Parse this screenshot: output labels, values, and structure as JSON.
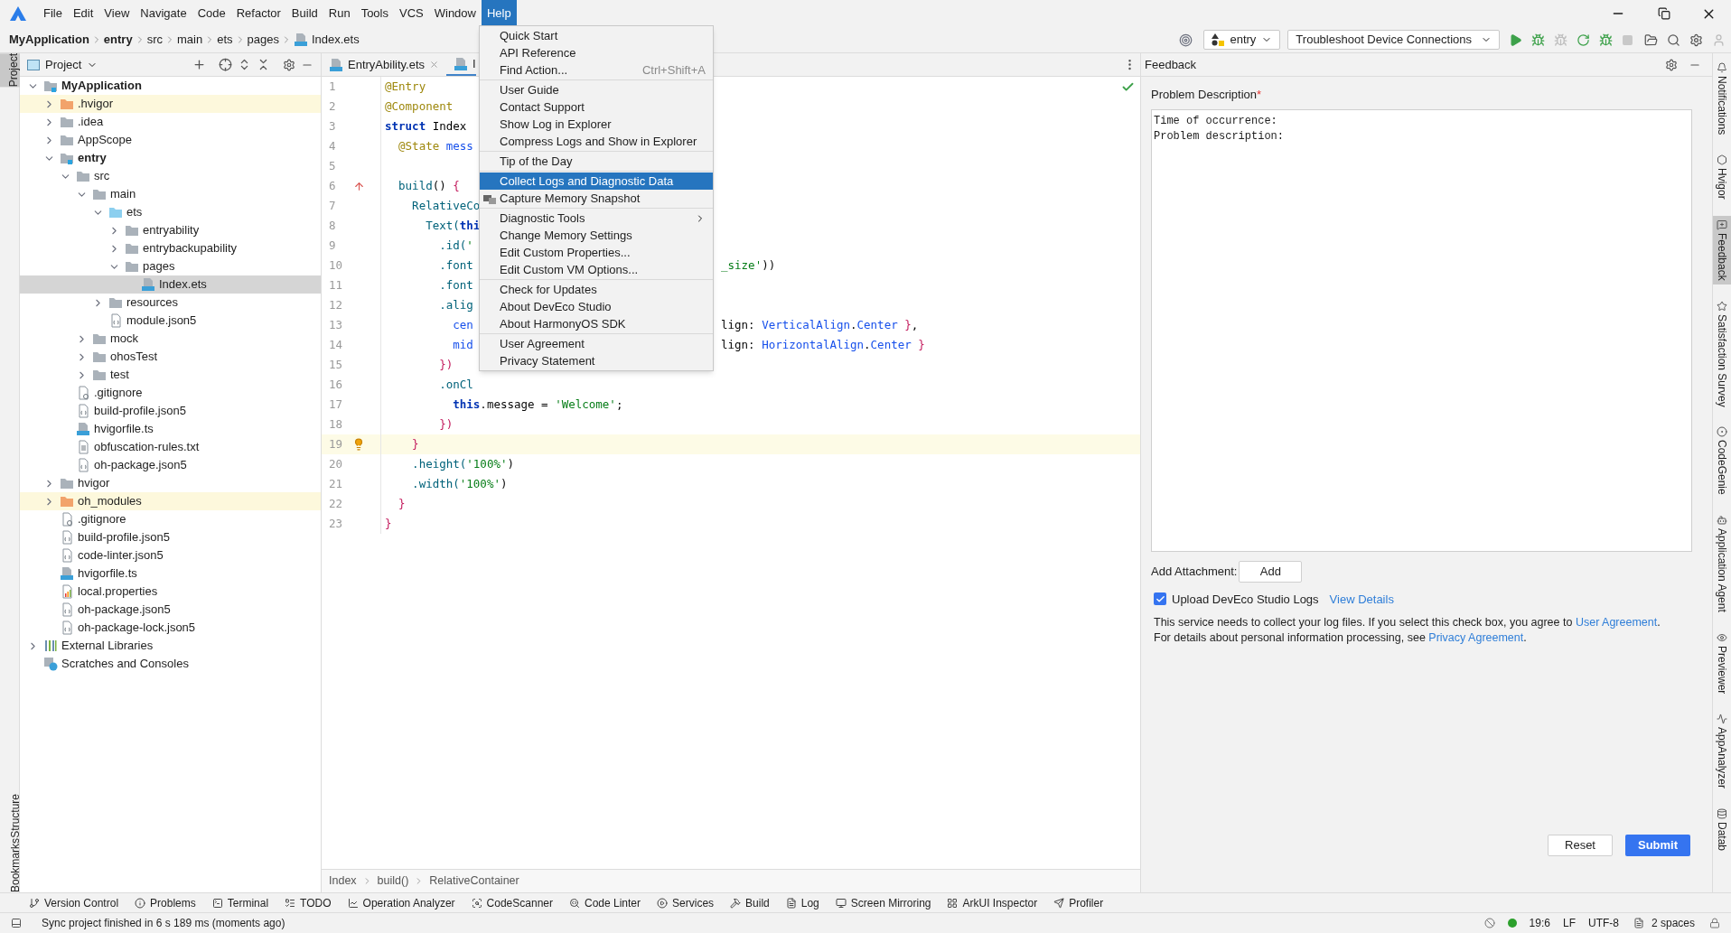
{
  "menu_bar": {
    "items": [
      {
        "label": "File",
        "selected": false
      },
      {
        "label": "Edit",
        "selected": false
      },
      {
        "label": "View",
        "selected": false
      },
      {
        "label": "Navigate",
        "selected": false
      },
      {
        "label": "Code",
        "selected": false
      },
      {
        "label": "Refactor",
        "selected": false
      },
      {
        "label": "Build",
        "selected": false
      },
      {
        "label": "Run",
        "selected": false
      },
      {
        "label": "Tools",
        "selected": false
      },
      {
        "label": "VCS",
        "selected": false
      },
      {
        "label": "Window",
        "selected": false
      },
      {
        "label": "Help",
        "selected": true
      }
    ]
  },
  "nav_bar": {
    "breadcrumbs": [
      {
        "label": "MyApplication",
        "kind": "module"
      },
      {
        "label": "entry",
        "kind": "module"
      },
      {
        "label": "src",
        "kind": "folder"
      },
      {
        "label": "main",
        "kind": "folder"
      },
      {
        "label": "ets",
        "kind": "folder"
      },
      {
        "label": "pages",
        "kind": "folder"
      },
      {
        "label": "Index.ets",
        "kind": "file"
      }
    ],
    "run_config": "entry",
    "device": "Troubleshoot Device Connections"
  },
  "help_menu": {
    "groups": [
      [
        {
          "label": "Quick Start",
          "kind": "plain",
          "selected": false
        },
        {
          "label": "API Reference",
          "kind": "plain",
          "selected": false
        },
        {
          "label": "Find Action...",
          "kind": "plain",
          "shortcut": "Ctrl+Shift+A",
          "selected": false
        }
      ],
      [
        {
          "label": "User Guide",
          "kind": "plain",
          "selected": false
        },
        {
          "label": "Contact Support",
          "kind": "plain",
          "selected": false
        },
        {
          "label": "Show Log in Explorer",
          "kind": "plain",
          "selected": false
        },
        {
          "label": "Compress Logs and Show in Explorer",
          "kind": "plain",
          "selected": false
        }
      ],
      [
        {
          "label": "Tip of the Day",
          "kind": "plain",
          "selected": false
        }
      ],
      [
        {
          "label": "Collect Logs and Diagnostic Data",
          "kind": "plain",
          "selected": true
        },
        {
          "label": "Capture Memory Snapshot",
          "kind": "with-icon",
          "selected": false
        }
      ],
      [
        {
          "label": "Diagnostic Tools",
          "kind": "submenu",
          "selected": false
        },
        {
          "label": "Change Memory Settings",
          "kind": "plain",
          "selected": false
        },
        {
          "label": "Edit Custom Properties...",
          "kind": "plain",
          "selected": false
        },
        {
          "label": "Edit Custom VM Options...",
          "kind": "plain",
          "selected": false
        }
      ],
      [
        {
          "label": "Check for Updates",
          "kind": "plain",
          "selected": false
        },
        {
          "label": "About DevEco Studio",
          "kind": "plain",
          "selected": false
        },
        {
          "label": "About HarmonyOS SDK",
          "kind": "plain",
          "selected": false
        }
      ],
      [
        {
          "label": "User Agreement",
          "kind": "plain",
          "selected": false
        },
        {
          "label": "Privacy Statement",
          "kind": "plain",
          "selected": false
        }
      ]
    ]
  },
  "left_stripe": {
    "top_tabs": [
      {
        "label": "Project",
        "selected": true
      }
    ],
    "bottom_tabs": [
      {
        "label": "Structure",
        "selected": false
      },
      {
        "label": "Bookmarks",
        "selected": false
      }
    ]
  },
  "project": {
    "title": "Project",
    "tree": [
      {
        "label": "MyApplication",
        "kind": "project",
        "expanded": true,
        "selected": false,
        "children": [
          {
            "label": ".hvigor",
            "kind": "excluded",
            "expanded": false,
            "selected": false
          },
          {
            "label": ".idea",
            "kind": "folder",
            "expanded": false,
            "selected": false
          },
          {
            "label": "AppScope",
            "kind": "folder",
            "expanded": false,
            "selected": false
          },
          {
            "label": "entry",
            "kind": "module",
            "expanded": true,
            "selected": false,
            "children": [
              {
                "label": "src",
                "kind": "folder",
                "expanded": true,
                "selected": false,
                "children": [
                  {
                    "label": "main",
                    "kind": "folder",
                    "expanded": true,
                    "selected": false,
                    "children": [
                      {
                        "label": "ets",
                        "kind": "source",
                        "expanded": true,
                        "selected": false,
                        "children": [
                          {
                            "label": "entryability",
                            "kind": "folder",
                            "expanded": false,
                            "selected": false
                          },
                          {
                            "label": "entrybackupability",
                            "kind": "folder",
                            "expanded": false,
                            "selected": false
                          },
                          {
                            "label": "pages",
                            "kind": "folder",
                            "expanded": true,
                            "selected": false,
                            "children": [
                              {
                                "label": "Index.ets",
                                "kind": "ets",
                                "selected": true
                              }
                            ]
                          }
                        ]
                      },
                      {
                        "label": "resources",
                        "kind": "folder",
                        "expanded": false,
                        "selected": false
                      },
                      {
                        "label": "module.json5",
                        "kind": "json",
                        "selected": false
                      }
                    ]
                  },
                  {
                    "label": "mock",
                    "kind": "folder",
                    "expanded": false,
                    "selected": false
                  },
                  {
                    "label": "ohosTest",
                    "kind": "folder",
                    "expanded": false,
                    "selected": false
                  },
                  {
                    "label": "test",
                    "kind": "folder",
                    "expanded": false,
                    "selected": false
                  }
                ]
              },
              {
                "label": ".gitignore",
                "kind": "ignore",
                "selected": false
              },
              {
                "label": "build-profile.json5",
                "kind": "json",
                "selected": false
              },
              {
                "label": "hvigorfile.ts",
                "kind": "ts",
                "selected": false
              },
              {
                "label": "obfuscation-rules.txt",
                "kind": "text",
                "selected": false
              },
              {
                "label": "oh-package.json5",
                "kind": "json",
                "selected": false
              }
            ]
          },
          {
            "label": "hvigor",
            "kind": "folder",
            "expanded": false,
            "selected": false
          },
          {
            "label": "oh_modules",
            "kind": "excluded",
            "expanded": false,
            "selected": false
          },
          {
            "label": ".gitignore",
            "kind": "ignore",
            "selected": false
          },
          {
            "label": "build-profile.json5",
            "kind": "json",
            "selected": false
          },
          {
            "label": "code-linter.json5",
            "kind": "json",
            "selected": false
          },
          {
            "label": "hvigorfile.ts",
            "kind": "ts",
            "selected": false
          },
          {
            "label": "local.properties",
            "kind": "props",
            "selected": false
          },
          {
            "label": "oh-package.json5",
            "kind": "json",
            "selected": false
          },
          {
            "label": "oh-package-lock.json5",
            "kind": "json",
            "selected": false
          }
        ]
      },
      {
        "label": "External Libraries",
        "kind": "libraries",
        "expanded": false,
        "selected": false
      },
      {
        "label": "Scratches and Consoles",
        "kind": "scratches",
        "selected": false
      }
    ]
  },
  "editor": {
    "tabs": [
      {
        "label": "EntryAbility.ets",
        "selected": false,
        "closable": true
      },
      {
        "label": "I",
        "selected": true,
        "closable": false
      }
    ],
    "lines": [
      {
        "number": "1",
        "current": false,
        "kind": "plain",
        "segments": [
          {
            "text": "@Entry",
            "kind": "ann"
          }
        ]
      },
      {
        "number": "2",
        "current": false,
        "kind": "plain",
        "segments": [
          {
            "text": "@Component",
            "kind": "ann"
          }
        ]
      },
      {
        "number": "3",
        "current": false,
        "kind": "plain",
        "segments": [
          {
            "text": "struct",
            "kind": "kw"
          },
          {
            "text": " Index",
            "kind": "type"
          }
        ]
      },
      {
        "number": "4",
        "current": false,
        "kind": "plain",
        "segments": [
          {
            "text": "  @State",
            "kind": "ann"
          },
          {
            "text": " mess",
            "kind": "field"
          }
        ]
      },
      {
        "number": "5",
        "current": false,
        "kind": "plain"
      },
      {
        "number": "6",
        "current": false,
        "kind": "override",
        "segments": [
          {
            "text": "  build",
            "kind": "func"
          },
          {
            "text": "() ",
            "kind": "plain"
          },
          {
            "text": "{",
            "kind": "brace"
          }
        ]
      },
      {
        "number": "7",
        "current": false,
        "kind": "plain",
        "segments": [
          {
            "text": "    RelativeCo",
            "kind": "func"
          }
        ]
      },
      {
        "number": "8",
        "current": false,
        "kind": "plain",
        "segments": [
          {
            "text": "      Text(",
            "kind": "func"
          },
          {
            "text": "thi",
            "kind": "kw"
          }
        ]
      },
      {
        "number": "9",
        "current": false,
        "kind": "plain",
        "segments": [
          {
            "text": "        .id(",
            "kind": "func"
          },
          {
            "text": "'",
            "kind": "string"
          }
        ]
      },
      {
        "number": "10",
        "current": false,
        "kind": "plain",
        "segments": [
          {
            "text": "        .font",
            "kind": "func"
          }
        ],
        "right": [
          {
            "text": "_size'",
            "kind": "string"
          },
          {
            "text": "))",
            "kind": "plain"
          }
        ]
      },
      {
        "number": "11",
        "current": false,
        "kind": "plain",
        "segments": [
          {
            "text": "        .font",
            "kind": "func"
          }
        ]
      },
      {
        "number": "12",
        "current": false,
        "kind": "plain",
        "segments": [
          {
            "text": "        .alig",
            "kind": "func"
          }
        ]
      },
      {
        "number": "13",
        "current": false,
        "kind": "plain",
        "segments": [
          {
            "text": "          cen",
            "kind": "field"
          }
        ],
        "right": [
          {
            "text": "lign: ",
            "kind": "plain"
          },
          {
            "text": "VerticalAlign",
            "kind": "field"
          },
          {
            "text": ".",
            "kind": "plain"
          },
          {
            "text": "Center",
            "kind": "field"
          },
          {
            "text": " }",
            "kind": "brace"
          },
          {
            "text": ",",
            "kind": "plain"
          }
        ]
      },
      {
        "number": "14",
        "current": false,
        "kind": "plain",
        "segments": [
          {
            "text": "          mid",
            "kind": "field"
          }
        ],
        "right": [
          {
            "text": "lign: ",
            "kind": "plain"
          },
          {
            "text": "HorizontalAlign",
            "kind": "field"
          },
          {
            "text": ".",
            "kind": "plain"
          },
          {
            "text": "Center",
            "kind": "field"
          },
          {
            "text": " }",
            "kind": "brace"
          }
        ]
      },
      {
        "number": "15",
        "current": false,
        "kind": "plain",
        "segments": [
          {
            "text": "        })",
            "kind": "brace"
          }
        ]
      },
      {
        "number": "16",
        "current": false,
        "kind": "plain",
        "segments": [
          {
            "text": "        .onCl",
            "kind": "func"
          }
        ]
      },
      {
        "number": "17",
        "current": false,
        "kind": "plain",
        "segments": [
          {
            "text": "          this",
            "kind": "kw"
          },
          {
            "text": ".message = ",
            "kind": "plain"
          },
          {
            "text": "'Welcome'",
            "kind": "string"
          },
          {
            "text": ";",
            "kind": "plain"
          }
        ]
      },
      {
        "number": "18",
        "current": false,
        "kind": "plain",
        "segments": [
          {
            "text": "        })",
            "kind": "brace"
          }
        ]
      },
      {
        "number": "19",
        "current": true,
        "kind": "bulb",
        "segments": [
          {
            "text": "    }",
            "kind": "brace"
          }
        ]
      },
      {
        "number": "20",
        "current": false,
        "kind": "plain",
        "segments": [
          {
            "text": "    .height(",
            "kind": "func"
          },
          {
            "text": "'100%'",
            "kind": "string"
          },
          {
            "text": ")",
            "kind": "plain"
          }
        ]
      },
      {
        "number": "21",
        "current": false,
        "kind": "plain",
        "segments": [
          {
            "text": "    .width(",
            "kind": "func"
          },
          {
            "text": "'100%'",
            "kind": "string"
          },
          {
            "text": ")",
            "kind": "plain"
          }
        ]
      },
      {
        "number": "22",
        "current": false,
        "kind": "plain",
        "segments": [
          {
            "text": "  }",
            "kind": "brace"
          }
        ]
      },
      {
        "number": "23",
        "current": false,
        "kind": "plain",
        "segments": [
          {
            "text": "}",
            "kind": "brace"
          }
        ]
      }
    ],
    "breadcrumbs": [
      "Index",
      "build()",
      "RelativeContainer"
    ]
  },
  "feedback": {
    "title": "Feedback",
    "label": "Problem Description",
    "required_mark": "*",
    "value": "Time of occurrence:\nProblem description:",
    "attachment_label": "Add Attachment:",
    "add_button": "Add",
    "upload": {
      "label": "Upload DevEco Studio Logs",
      "checked": true,
      "link": "View Details"
    },
    "notice": [
      {
        "text": "This service needs to collect your log files. If you select this check box, you agree to ",
        "link": false
      },
      {
        "text": "User Agreement",
        "link": true
      },
      {
        "text": ". For details about personal information processing, see ",
        "link": false
      },
      {
        "text": "Privacy Agreement",
        "link": true
      },
      {
        "text": ".",
        "link": false
      }
    ],
    "buttons": [
      {
        "label": "Reset",
        "kind": "secondary"
      },
      {
        "label": "Submit",
        "kind": "primary"
      }
    ]
  },
  "right_stripe": {
    "tabs": [
      {
        "label": "Notifications",
        "selected": false
      },
      {
        "label": "Hvigor",
        "selected": false
      },
      {
        "label": "Feedback",
        "selected": true
      },
      {
        "label": "Satisfaction Survey",
        "selected": false
      },
      {
        "label": "CodeGenie",
        "selected": false
      },
      {
        "label": "Application Agent",
        "selected": false
      },
      {
        "label": "Previewer",
        "selected": false
      },
      {
        "label": "AppAnalyzer",
        "selected": false
      },
      {
        "label": "Datab",
        "selected": false
      }
    ]
  },
  "tool_tabs": [
    "Version Control",
    "Problems",
    "Terminal",
    "TODO",
    "Operation Analyzer",
    "CodeScanner",
    "Code Linter",
    "Services",
    "Build",
    "Log",
    "Screen Mirroring",
    "ArkUI Inspector",
    "Profiler"
  ],
  "status_bar": {
    "message": "Sync project finished in 6 s 189 ms (moments ago)",
    "position": "19:6",
    "line_ending": "LF",
    "encoding": "UTF-8",
    "indent": "2 spaces"
  }
}
